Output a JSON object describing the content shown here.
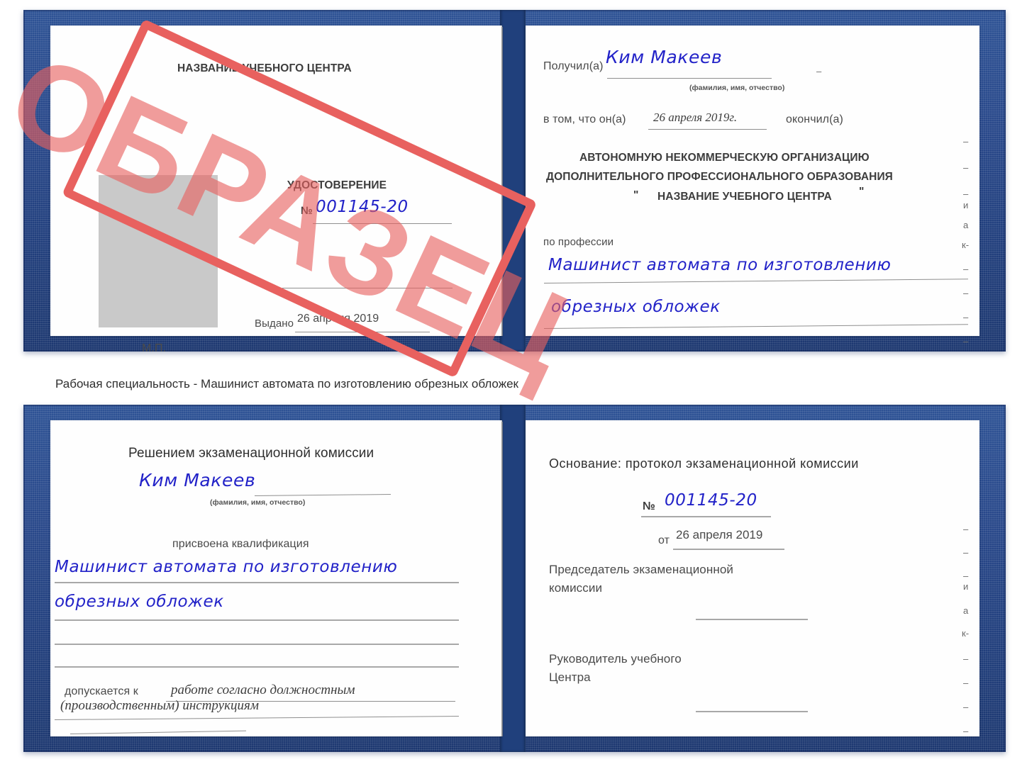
{
  "document": {
    "type": "Удостоверение",
    "caption": "Рабочая специальность - Машинист автомата по изготовлению обрезных обложек",
    "stamp_text": "ОБРАЗЕЦ",
    "stamp_color": "#e8615f",
    "cover_color": "#22407e",
    "ink_color": "#2222c8"
  },
  "cert1": {
    "left_page": {
      "org_title": "НАЗВАНИЕ УЧЕБНОГО ЦЕНТРА",
      "doc_title": "УДОСТОВЕРЕНИЕ",
      "number_label": "№",
      "number_value": "001145-20",
      "issued_label": "Выдано",
      "issued_value": "26 апреля 2019",
      "seal_label": "М.П."
    },
    "right_page": {
      "received_label": "Получил(а)",
      "received_value": "Ким Макеев",
      "name_hint": "(фамилия, имя, отчество)",
      "in_that_label": "в том, что он(а)",
      "in_that_value": "26 апреля 2019г.",
      "finished_label": "окончил(а)",
      "org_line1": "АВТОНОМНУЮ НЕКОММЕРЧЕСКУЮ ОРГАНИЗАЦИЮ",
      "org_line2": "ДОПОЛНИТЕЛЬНОГО ПРОФЕССИОНАЛЬНОГО ОБРАЗОВАНИЯ",
      "org_quote_open": "\"",
      "org_line3": "НАЗВАНИЕ УЧЕБНОГО ЦЕНТРА",
      "org_quote_close": "\"",
      "profession_label": "по профессии",
      "profession_line1": "Машинист автомата по изготовлению",
      "profession_line2": "обрезных обложек"
    },
    "edge_chars": [
      "–",
      "–",
      "–",
      "и",
      "а",
      "к-",
      "–",
      "–",
      "–",
      "–"
    ]
  },
  "cert2": {
    "left_page": {
      "decision_title": "Решением экзаменационной комиссии",
      "name_value": "Ким Макеев",
      "name_hint": "(фамилия, имя, отчество)",
      "qualification_label": "присвоена квалификация",
      "qualification_line1": "Машинист автомата по изготовлению",
      "qualification_line2": "обрезных обложек",
      "admitted_label": "допускается к",
      "admitted_line1": "работе согласно должностным",
      "admitted_line2": "(производственным) инструкциям"
    },
    "right_page": {
      "basis_label": "Основание: протокол экзаменационной комиссии",
      "number_label": "№",
      "number_value": "001145-20",
      "date_label": "от",
      "date_value": "26 апреля 2019",
      "chairman_line1": "Председатель экзаменационной",
      "chairman_line2": "комиссии",
      "head_line1": "Руководитель учебного",
      "head_line2": "Центра"
    },
    "edge_chars": [
      "–",
      "–",
      "–",
      "и",
      "а",
      "к-",
      "–",
      "–",
      "–",
      "–"
    ]
  }
}
